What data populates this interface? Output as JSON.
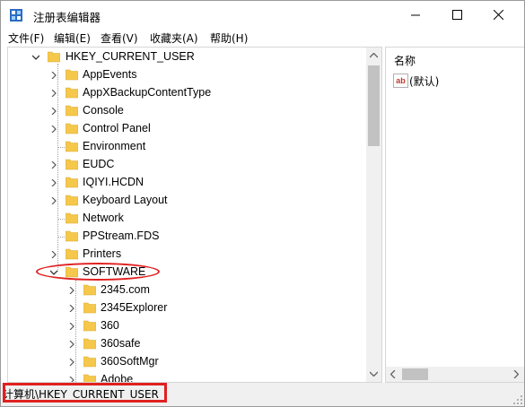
{
  "window": {
    "title": "注册表编辑器",
    "icon": "registry-editor-icon"
  },
  "menu": {
    "items": [
      "文件(F)",
      "编辑(E)",
      "查看(V)",
      "收藏夹(A)",
      "帮助(H)"
    ]
  },
  "tree": {
    "root": "HKEY_CURRENT_USER",
    "children": [
      {
        "label": "AppEvents",
        "expandable": true
      },
      {
        "label": "AppXBackupContentType",
        "expandable": true
      },
      {
        "label": "Console",
        "expandable": true
      },
      {
        "label": "Control Panel",
        "expandable": true
      },
      {
        "label": "Environment",
        "expandable": false
      },
      {
        "label": "EUDC",
        "expandable": true
      },
      {
        "label": "IQIYI.HCDN",
        "expandable": true
      },
      {
        "label": "Keyboard Layout",
        "expandable": true
      },
      {
        "label": "Network",
        "expandable": false
      },
      {
        "label": "PPStream.FDS",
        "expandable": false
      },
      {
        "label": "Printers",
        "expandable": true
      },
      {
        "label": "SOFTWARE",
        "expandable": true,
        "expanded": true
      }
    ],
    "software_children": [
      {
        "label": "2345.com"
      },
      {
        "label": "2345Explorer"
      },
      {
        "label": "360"
      },
      {
        "label": "360safe"
      },
      {
        "label": "360SoftMgr"
      },
      {
        "label": "Adobe"
      }
    ]
  },
  "list": {
    "column_name": "名称",
    "values": [
      {
        "icon": "string-value-icon",
        "icon_text": "ab",
        "name": "(默认)"
      }
    ]
  },
  "status": {
    "path": "计算机\\HKEY_CURRENT_USER"
  },
  "colors": {
    "folder": "#f5c84c",
    "highlight": "#e02020",
    "chrome": "#f0f0f0"
  }
}
